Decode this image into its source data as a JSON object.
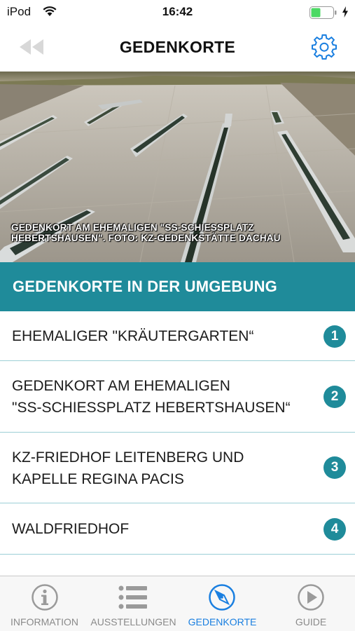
{
  "status_bar": {
    "device": "iPod",
    "time": "16:42"
  },
  "nav": {
    "title": "GEDENKORTE",
    "back_icon": "double-chevron-left-icon",
    "settings_icon": "gear-icon"
  },
  "hero": {
    "caption_line1": "GEDENKORT AM EHEMALIGEN \"SS-SCHIESSPLATZ",
    "caption_line2": "HEBERTSHAUSEN\". FOTO: KZ-GEDENKSTÄTTE DACHAU"
  },
  "section": {
    "title": "GEDENKORTE IN DER UMGEBUNG"
  },
  "sites": [
    {
      "lines": [
        "EHEMALIGER \"KRÄUTERGARTEN“"
      ],
      "number": "1"
    },
    {
      "lines": [
        "GEDENKORT AM EHEMALIGEN",
        "\"SS-SCHIESSPLATZ HEBERTSHAUSEN“"
      ],
      "number": "2"
    },
    {
      "lines": [
        "KZ-FRIEDHOF LEITENBERG UND",
        "KAPELLE REGINA PACIS"
      ],
      "number": "3"
    },
    {
      "lines": [
        "WALDFRIEDHOF"
      ],
      "number": "4"
    }
  ],
  "tabs": [
    {
      "label": "INFORMATION",
      "icon": "info-icon",
      "active": false
    },
    {
      "label": "AUSSTELLUNGEN",
      "icon": "list-icon",
      "active": false
    },
    {
      "label": "GEDENKORTE",
      "icon": "compass-icon",
      "active": true
    },
    {
      "label": "GUIDE",
      "icon": "play-icon",
      "active": false
    }
  ],
  "colors": {
    "accent": "#1f8b9a",
    "tab_active": "#1a7fe0",
    "tab_inactive": "#8a8a8a",
    "battery": "#4cd964"
  }
}
